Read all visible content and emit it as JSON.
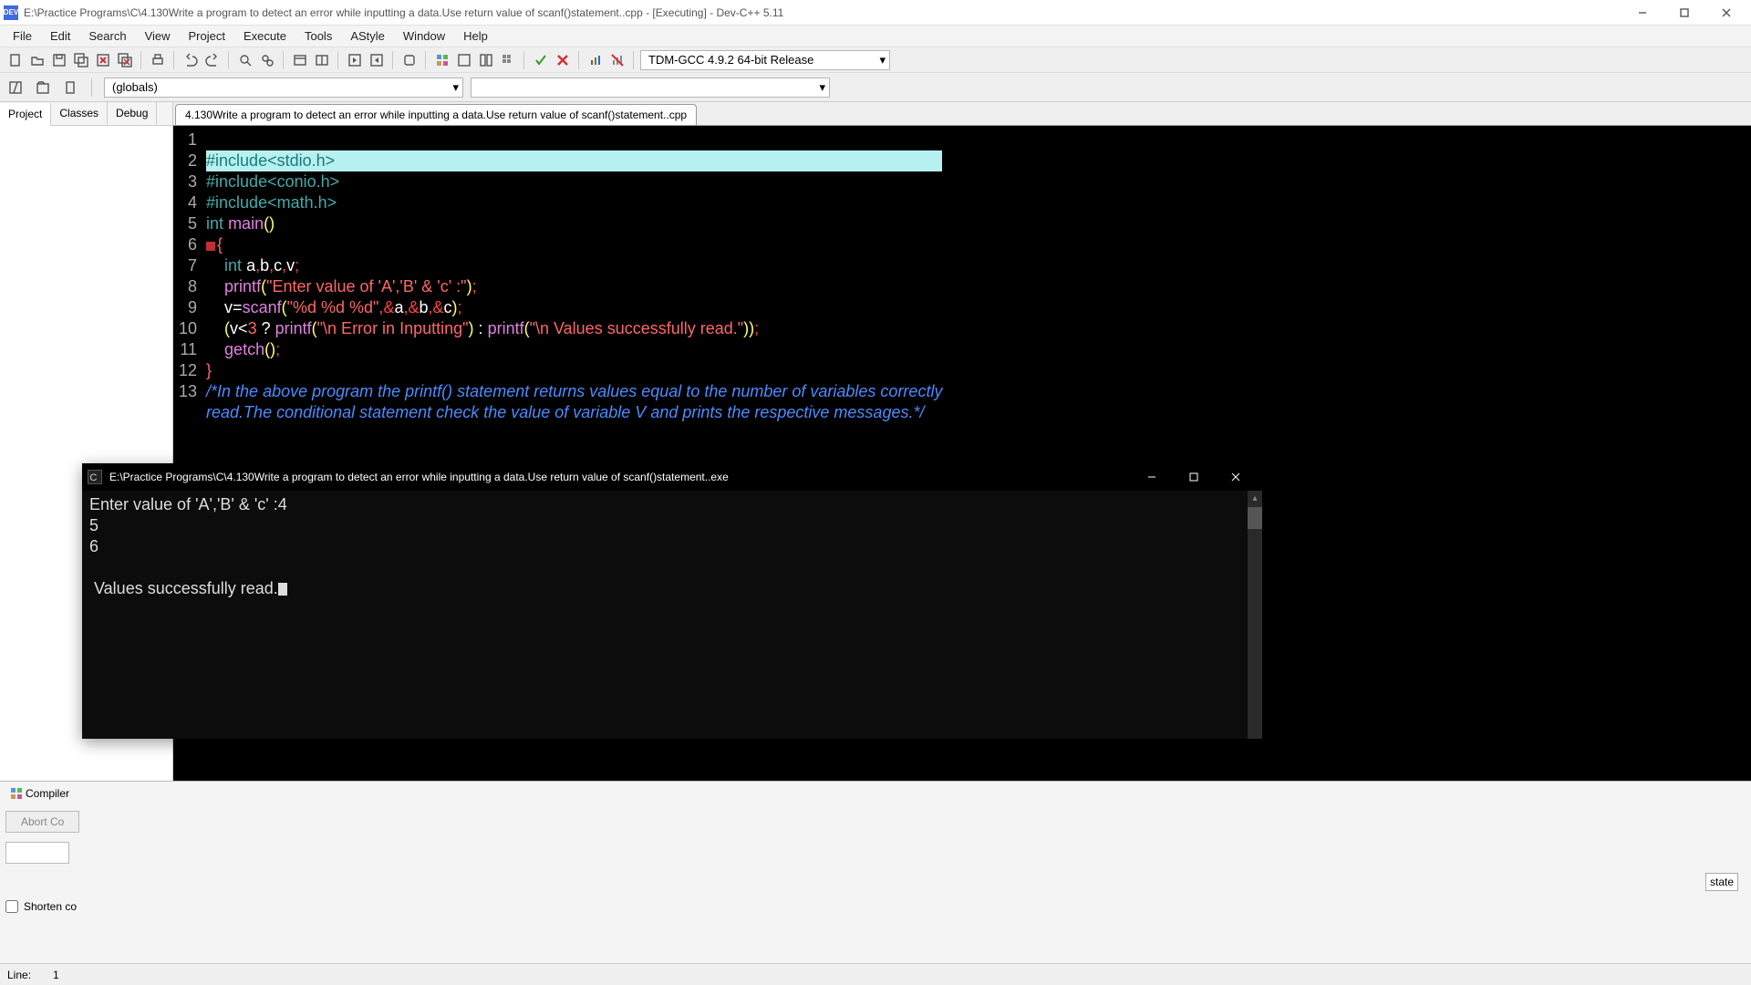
{
  "window": {
    "title": "E:\\Practice Programs\\C\\4.130Write a program to detect an error while inputting a data.Use return value of scanf()statement..cpp - [Executing] - Dev-C++ 5.11",
    "app_icon_text": "DEV"
  },
  "menu": {
    "items": [
      "File",
      "Edit",
      "Search",
      "View",
      "Project",
      "Execute",
      "Tools",
      "AStyle",
      "Window",
      "Help"
    ]
  },
  "compiler_combo": "TDM-GCC 4.9.2 64-bit Release",
  "scope_combo": "(globals)",
  "side_tabs": [
    "Project",
    "Classes",
    "Debug"
  ],
  "file_tab": "4.130Write a program to detect an error while inputting a data.Use return value of scanf()statement..cpp",
  "code": {
    "lines": [
      "#include<stdio.h>",
      "#include<conio.h>",
      "#include<math.h>",
      "int main()",
      "{",
      "    int a,b,c,v;",
      "    printf(\"Enter value of 'A','B' & 'c' :\");",
      "    v=scanf(\"%d %d %d\",&a,&b,&c);",
      "    (v<3 ? printf(\"\\n Error in Inputting\") : printf(\"\\n Values successfully read.\"));",
      "    getch();",
      "}",
      "/*In the above program the printf() statement returns values equal to the number of variables correctly",
      "read.The conditional statement check the value of variable V and prints the respective messages.*/"
    ]
  },
  "bottom": {
    "tab": "Compiler",
    "abort": "Abort Co",
    "shorten": "Shorten co",
    "right_fragment": "state"
  },
  "status": {
    "line_label": "Line:",
    "line_value": "1"
  },
  "console": {
    "title": "E:\\Practice Programs\\C\\4.130Write a program to detect an error while inputting a data.Use return value of scanf()statement..exe",
    "out_line1": "Enter value of 'A','B' & 'c' :4",
    "out_line2": "5",
    "out_line3": "6",
    "out_blank": "",
    "out_line4": " Values successfully read."
  }
}
